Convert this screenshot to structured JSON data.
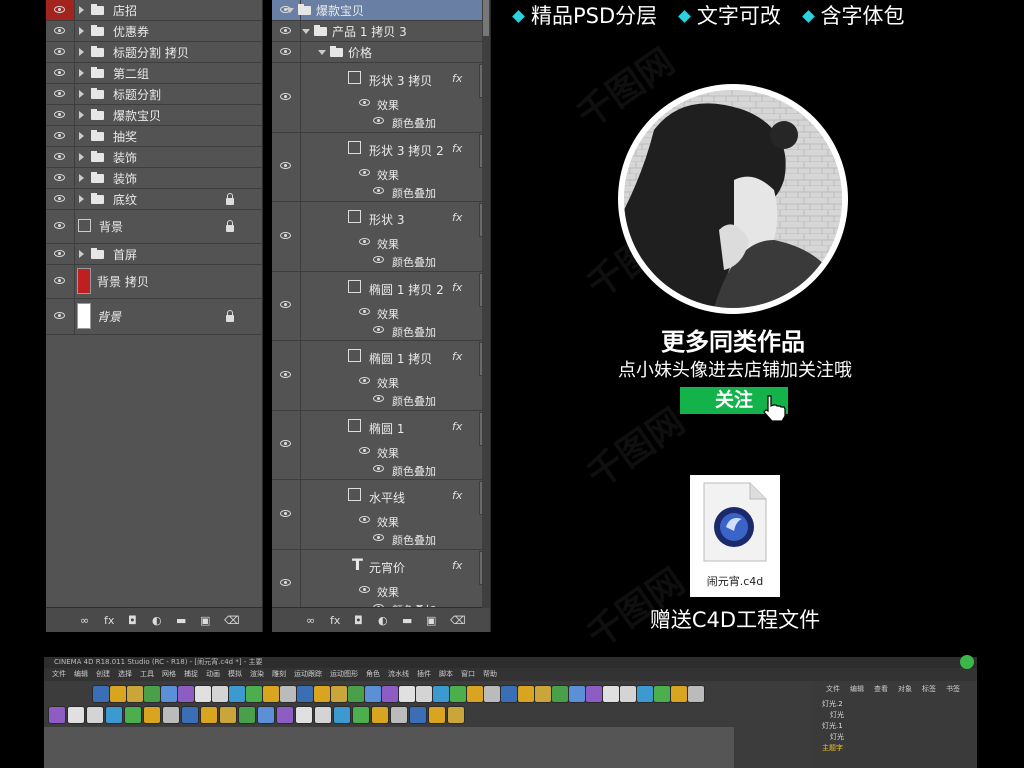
{
  "left_panel": {
    "layers": [
      {
        "name": "店招",
        "type": "group",
        "red_eye": true
      },
      {
        "name": "优惠券",
        "type": "group"
      },
      {
        "name": "标题分割 拷贝",
        "type": "group"
      },
      {
        "name": "第二组",
        "type": "group"
      },
      {
        "name": "标题分割",
        "type": "group"
      },
      {
        "name": "爆款宝贝",
        "type": "group"
      },
      {
        "name": "抽奖",
        "type": "group"
      },
      {
        "name": "装饰",
        "type": "group"
      },
      {
        "name": "装饰",
        "type": "group"
      },
      {
        "name": "底纹",
        "type": "group",
        "locked": true
      },
      {
        "name": "背景",
        "type": "layer",
        "locked": true
      },
      {
        "name": "首屏",
        "type": "group"
      },
      {
        "name": "背景 拷贝",
        "type": "fill",
        "color": "#c01f1f"
      },
      {
        "name": "背景",
        "type": "fill",
        "color": "#ffffff",
        "locked": true
      }
    ]
  },
  "right_panel": {
    "header": "爆款宝贝",
    "sub1": "产品 1 拷贝 3",
    "sub2": "价格",
    "layers": [
      {
        "name": "形状 3 拷贝",
        "effect": "效果",
        "overlay": "颜色叠加"
      },
      {
        "name": "形状 3 拷贝 2",
        "effect": "效果",
        "overlay": "颜色叠加"
      },
      {
        "name": "形状 3",
        "effect": "效果",
        "overlay": "颜色叠加"
      },
      {
        "name": "椭圆 1 拷贝 2",
        "effect": "效果",
        "overlay": "颜色叠加"
      },
      {
        "name": "椭圆 1 拷贝",
        "effect": "效果",
        "overlay": "颜色叠加"
      },
      {
        "name": "椭圆 1",
        "effect": "效果",
        "overlay": "颜色叠加"
      },
      {
        "name": "水平线",
        "effect": "效果",
        "overlay": "颜色叠加"
      },
      {
        "name": "元宵价",
        "effect": "效果",
        "overlay": "颜色叠加",
        "text_layer": true
      }
    ]
  },
  "banner": {
    "items": [
      "精品PSD分层",
      "文字可改",
      "含字体包"
    ],
    "accent": "#2ad2e0"
  },
  "promo": {
    "title": "更多同类作品",
    "subtitle": "点小妹头像进去店铺加关注哦",
    "follow_label": "关注",
    "follow_color": "#14b24b"
  },
  "file": {
    "name": "闹元宵.c4d",
    "gift": "赠送C4D工程文件"
  },
  "c4d": {
    "title": "CINEMA 4D R18.011 Studio (RC - R18) - [闹元宵.c4d *] - 主要",
    "menu": [
      "文件",
      "编辑",
      "创建",
      "选择",
      "工具",
      "网格",
      "捕捉",
      "动画",
      "模拟",
      "渲染",
      "雕刻",
      "运动跟踪",
      "运动图形",
      "角色",
      "流水线",
      "插件",
      "脚本",
      "窗口",
      "帮助"
    ],
    "objects_tabs": [
      "文件",
      "编辑",
      "查看",
      "对象",
      "标签",
      "书签"
    ],
    "objects": [
      "灯光.2",
      "灯光",
      "灯光.1",
      "灯光",
      "主题字"
    ]
  }
}
